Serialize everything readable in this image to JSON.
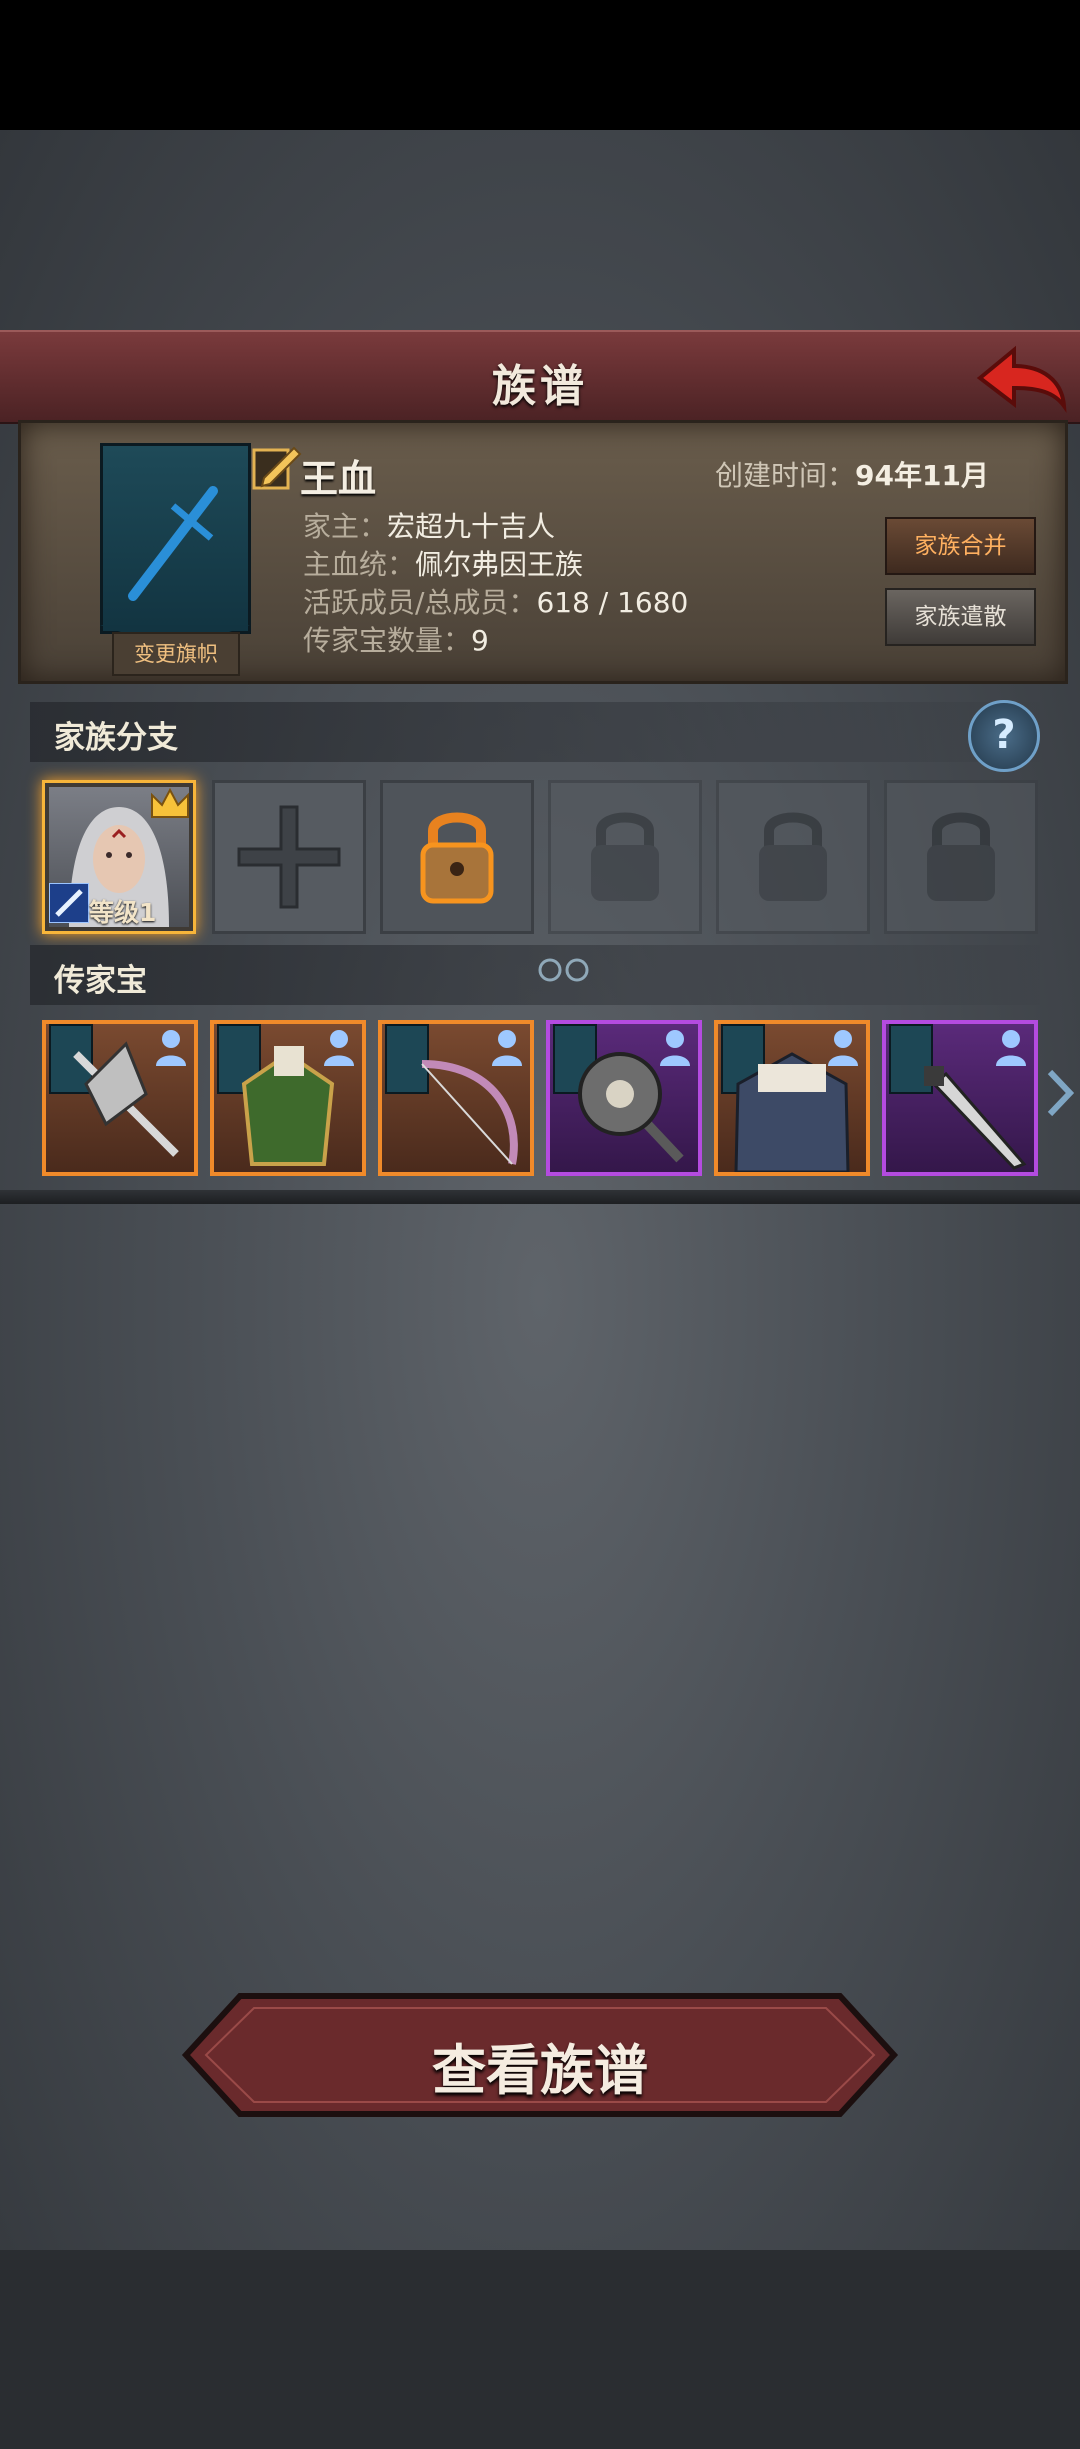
{
  "header": {
    "title": "族谱"
  },
  "family": {
    "name": "王血",
    "banner_button": "变更旗帜",
    "created_label": "创建时间：",
    "created_value": "94年11月",
    "leader_label": "家主：",
    "leader_value": "宏超九十吉人",
    "bloodline_label": "主血统：",
    "bloodline_value": "佩尔弗因王族",
    "members_label": "活跃成员/总成员：",
    "members_value": "618 / 1680",
    "heirloom_count_label": "传家宝数量：",
    "heirloom_count_value": "9",
    "merge_button": "家族合并",
    "dissolve_button": "家族遣散"
  },
  "branches": {
    "title": "家族分支",
    "active_level": "等级1"
  },
  "heirlooms": {
    "title": "传家宝",
    "items": [
      {
        "rarity": "orange",
        "icon": "halberd-icon"
      },
      {
        "rarity": "orange",
        "icon": "armor-icon"
      },
      {
        "rarity": "orange",
        "icon": "bow-icon"
      },
      {
        "rarity": "purple",
        "icon": "skull-axe-icon"
      },
      {
        "rarity": "orange",
        "icon": "cloak-icon"
      },
      {
        "rarity": "purple",
        "icon": "dagger-icon"
      }
    ]
  },
  "footer": {
    "view_button": "查看族谱"
  },
  "colors": {
    "title_bar": "#5e2c2e",
    "orange_rarity": "#f08a2a",
    "purple_rarity": "#b44be0",
    "gold": "#f7b53a"
  }
}
